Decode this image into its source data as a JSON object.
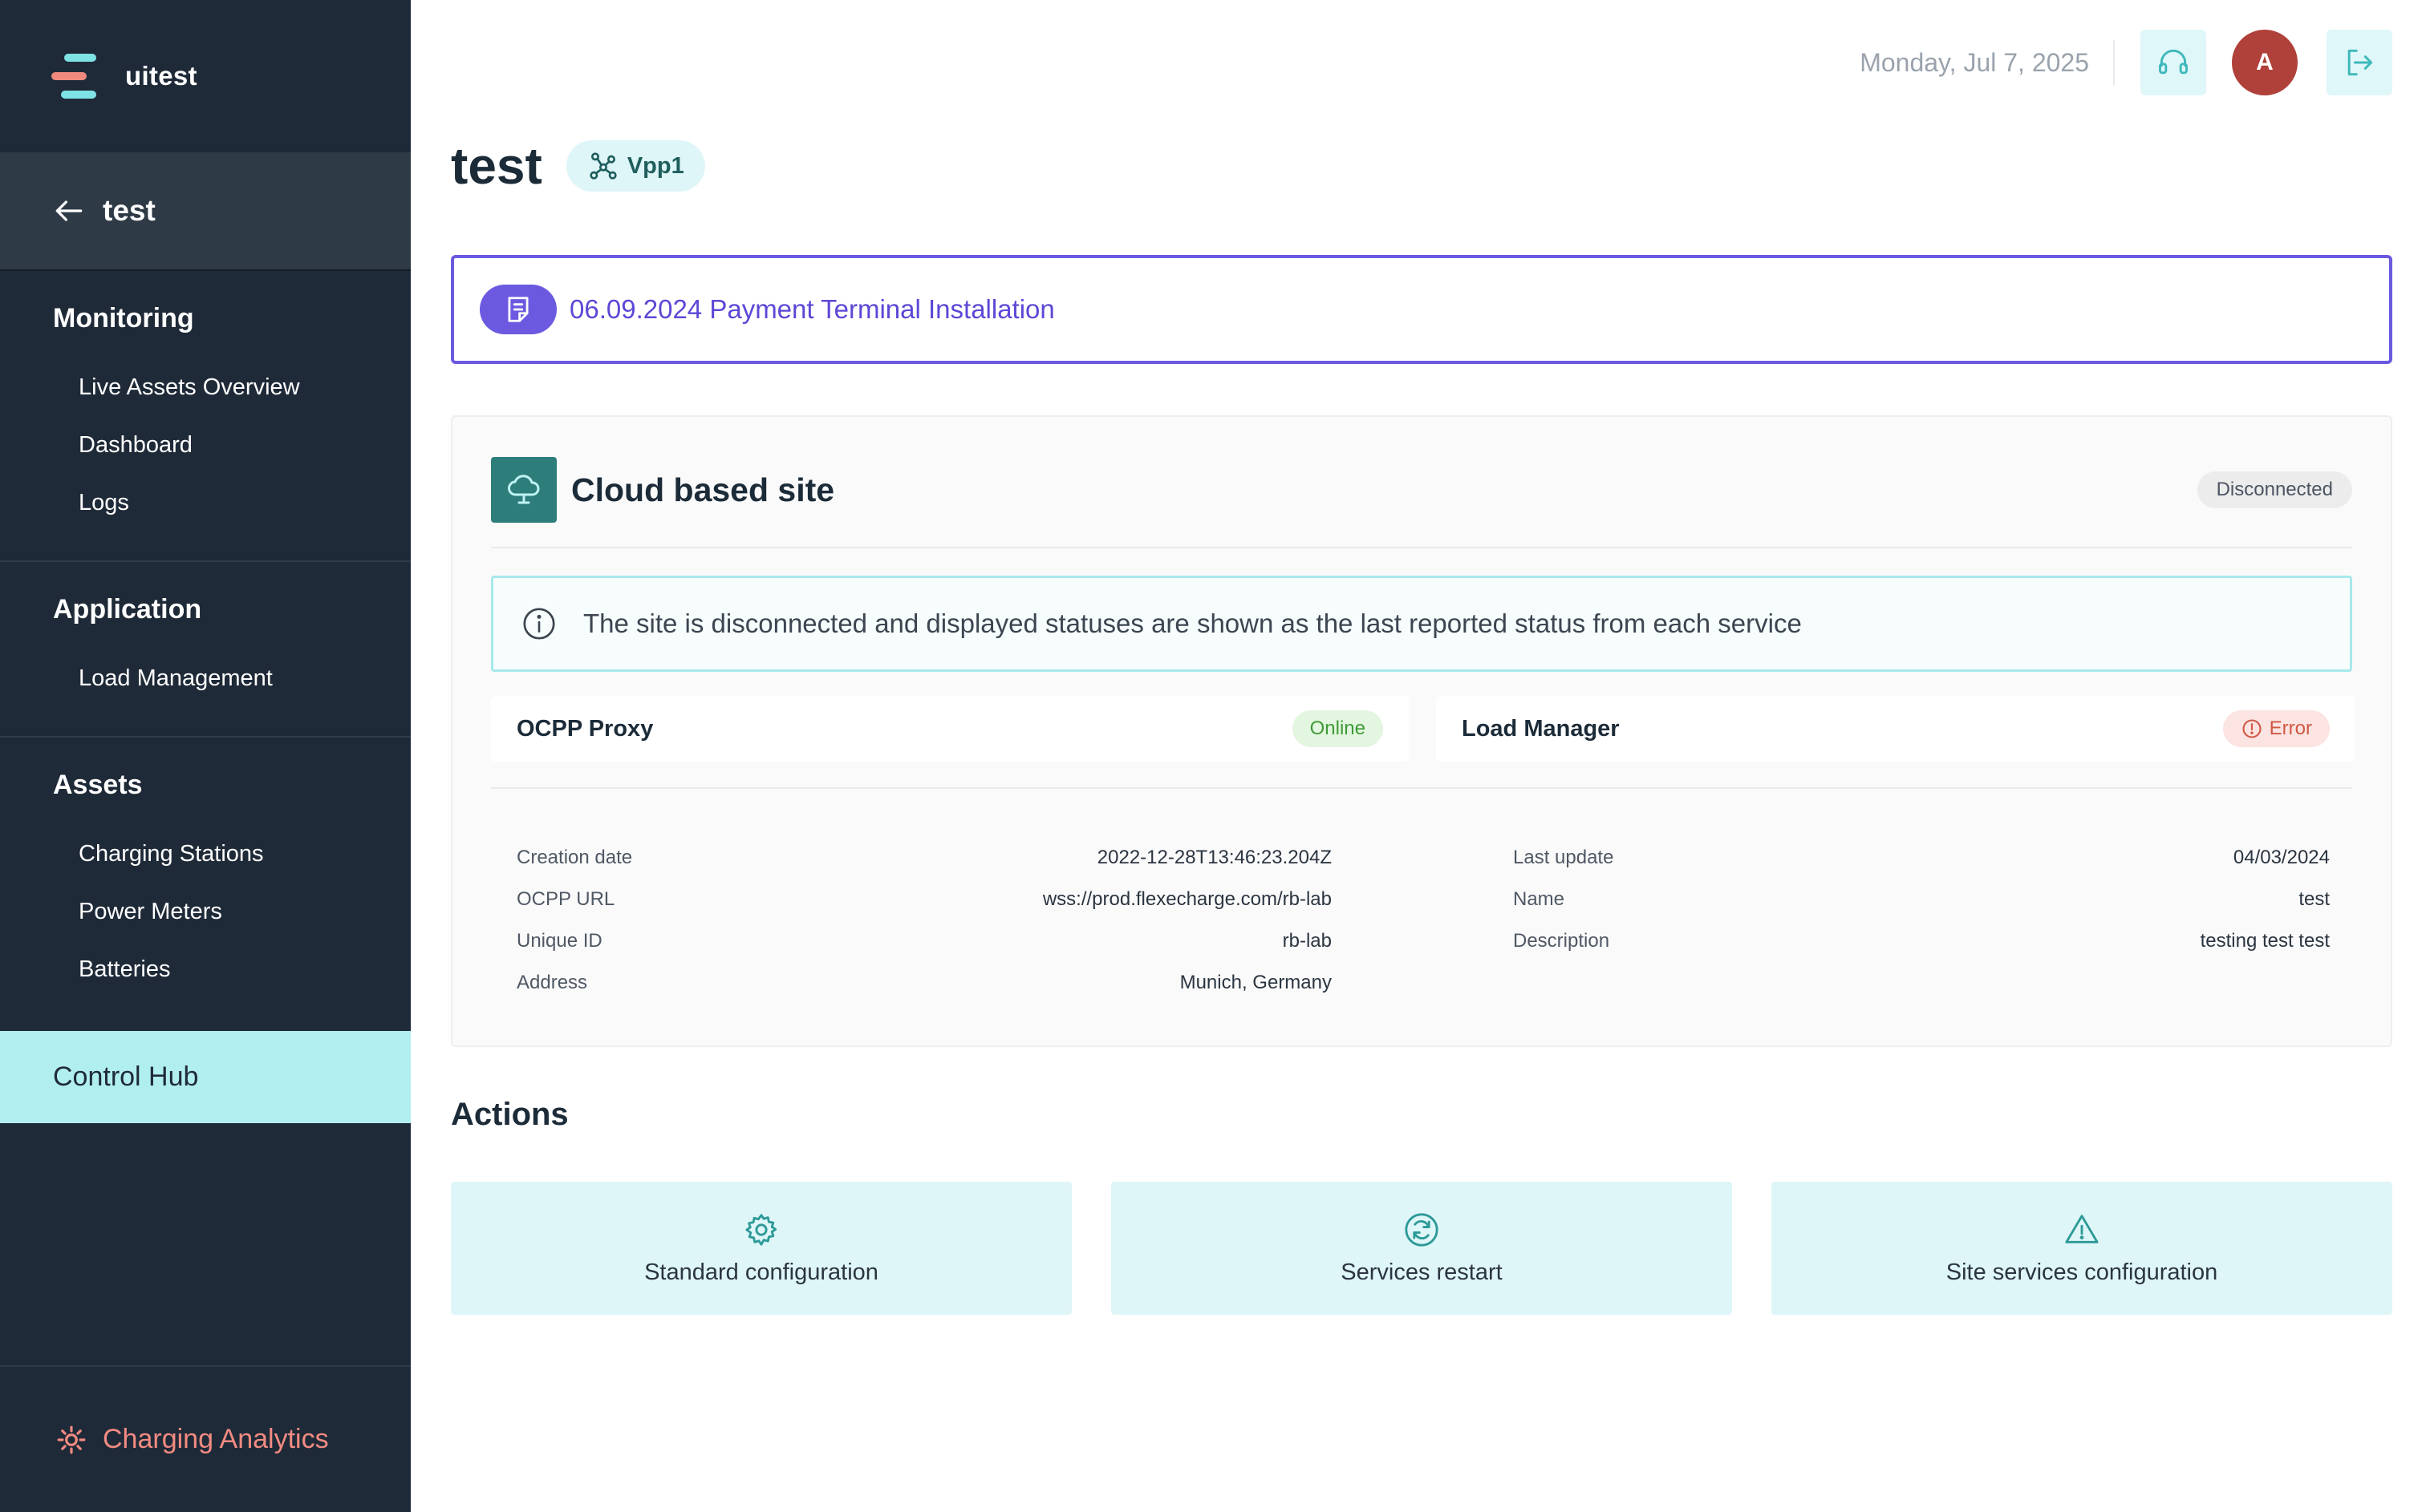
{
  "app": {
    "name": "uitest"
  },
  "sidebar": {
    "back_label": "test",
    "sections": [
      {
        "heading": "Monitoring",
        "items": [
          "Live Assets Overview",
          "Dashboard",
          "Logs"
        ]
      },
      {
        "heading": "Application",
        "items": [
          "Load Management"
        ]
      },
      {
        "heading": "Assets",
        "items": [
          "Charging Stations",
          "Power Meters",
          "Batteries"
        ]
      }
    ],
    "active_item": "Control Hub",
    "footer_link": "Charging Analytics"
  },
  "topbar": {
    "date": "Monday, Jul 7, 2025",
    "avatar_initial": "A",
    "icons": [
      "headset-icon",
      "logout-icon"
    ]
  },
  "page": {
    "title": "test",
    "vpp_tag": "Vpp1",
    "note": "06.09.2024 Payment Terminal Installation"
  },
  "site": {
    "title": "Cloud based site",
    "status": "Disconnected",
    "banner": "The site is disconnected and displayed statuses are shown as the last reported status from each service",
    "services": [
      {
        "name": "OCPP Proxy",
        "status": "Online"
      },
      {
        "name": "Load Manager",
        "status": "Error"
      }
    ],
    "details_left": [
      {
        "label": "Creation date",
        "value": "2022-12-28T13:46:23.204Z"
      },
      {
        "label": "OCPP URL",
        "value": "wss://prod.flexecharge.com/rb-lab"
      },
      {
        "label": "Unique ID",
        "value": "rb-lab"
      },
      {
        "label": "Address",
        "value": "Munich, Germany"
      }
    ],
    "details_right": [
      {
        "label": "Last update",
        "value": "04/03/2024"
      },
      {
        "label": "Name",
        "value": "test"
      },
      {
        "label": "Description",
        "value": "testing test test"
      }
    ]
  },
  "actions": {
    "title": "Actions",
    "items": [
      {
        "label": "Standard configuration",
        "icon": "gear-icon"
      },
      {
        "label": "Services restart",
        "icon": "refresh-icon"
      },
      {
        "label": "Site services configuration",
        "icon": "warning-icon"
      }
    ]
  },
  "colors": {
    "sidebar_bg": "#1f2a38",
    "active_nav": "#b1eeef",
    "accent_teal": "#2d7d7b",
    "note_purple": "#6b5ae0",
    "analytics_coral": "#f28b81",
    "online_green": "#3f9a36",
    "error_red": "#d25846"
  }
}
